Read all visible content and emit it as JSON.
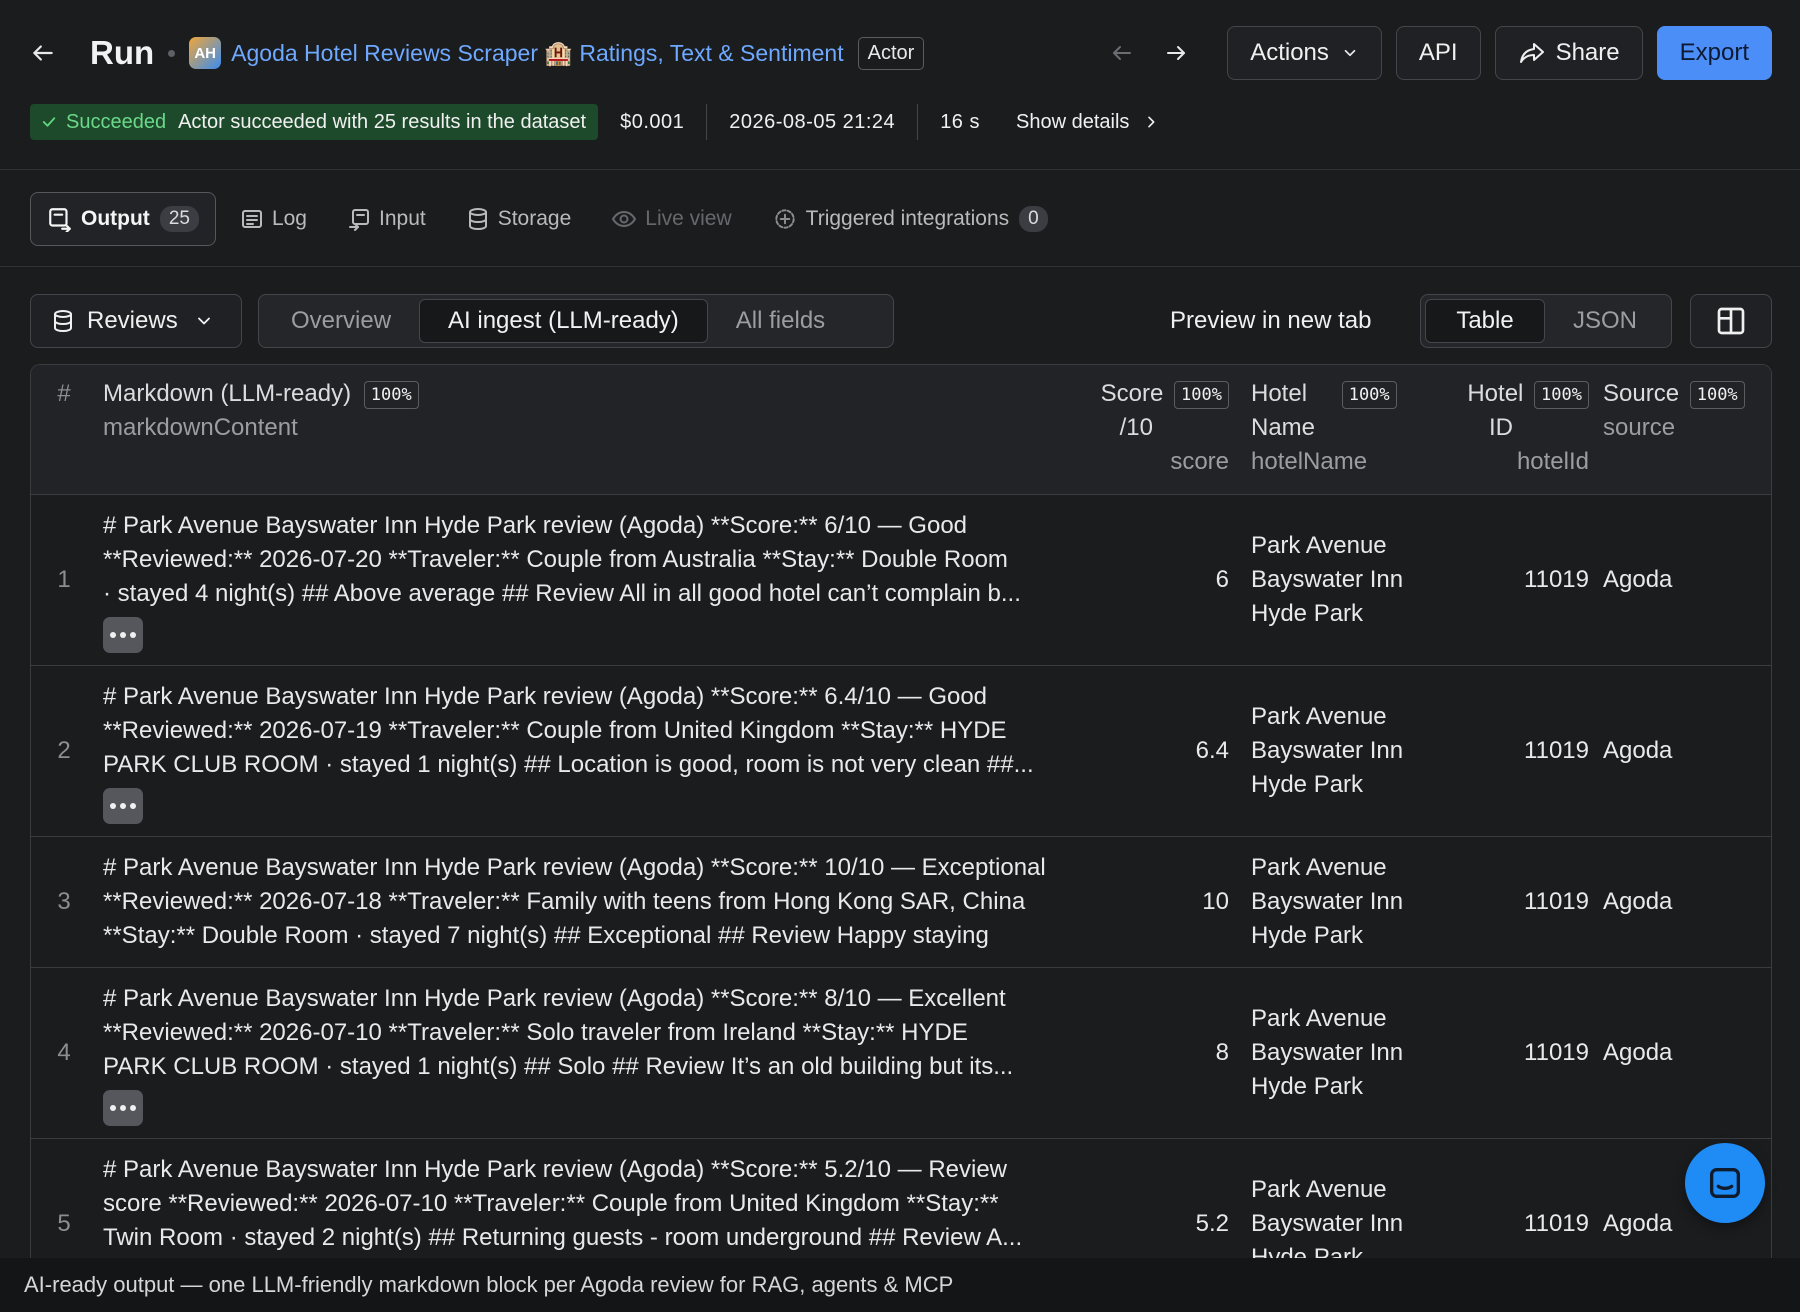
{
  "header": {
    "title": "Run",
    "actor_logo_text": "AH",
    "actor_name": "Agoda Hotel Reviews Scraper 🏨 Ratings, Text & Sentiment",
    "actor_badge": "Actor",
    "actions_label": "Actions",
    "api_label": "API",
    "share_label": "Share",
    "export_label": "Export"
  },
  "status": {
    "label": "Succeeded",
    "message": "Actor succeeded with 25 results in the dataset",
    "cost": "$0.001",
    "started": "2026-08-05 21:24",
    "duration": "16 s",
    "show_details": "Show details"
  },
  "tabs": [
    {
      "label": "Output",
      "count": "25",
      "active": true
    },
    {
      "label": "Log"
    },
    {
      "label": "Input"
    },
    {
      "label": "Storage"
    },
    {
      "label": "Live view",
      "disabled": true
    },
    {
      "label": "Triggered integrations",
      "count": "0"
    }
  ],
  "toolbar": {
    "dataset": "Reviews",
    "views": [
      "Overview",
      "AI ingest (LLM-ready)",
      "All fields"
    ],
    "active_view": "AI ingest (LLM-ready)",
    "preview_label": "Preview in new tab",
    "formats": [
      "Table",
      "JSON"
    ],
    "active_format": "Table"
  },
  "table": {
    "index_header": "#",
    "columns": {
      "markdown": {
        "title": "Markdown (LLM-ready)",
        "pct": "100%",
        "field": "markdownContent"
      },
      "score": {
        "title_line1": "Score",
        "title_line2": "/10",
        "pct": "100%",
        "field": "score"
      },
      "hotel_name": {
        "title_line1": "Hotel",
        "title_line2": "Name",
        "pct": "100%",
        "field": "hotelName"
      },
      "hotel_id": {
        "title_line1": "Hotel",
        "title_line2": "ID",
        "pct": "100%",
        "field": "hotelId"
      },
      "source": {
        "title": "Source",
        "pct": "100%",
        "field": "source"
      }
    },
    "rows": [
      {
        "index": "1",
        "markdown": [
          "# Park Avenue Bayswater Inn Hyde Park review (Agoda) **Score:** 6/10 — Good",
          "**Reviewed:** 2026-07-20 **Traveler:** Couple from Australia **Stay:** Double Room",
          "· stayed 4 night(s) ## Above average ## Review All in all good hotel can’t complain b..."
        ],
        "more": true,
        "score": "6",
        "hotel_name": [
          "Park Avenue",
          "Bayswater Inn",
          "Hyde Park"
        ],
        "hotel_id": "11019",
        "source": "Agoda"
      },
      {
        "index": "2",
        "markdown": [
          "# Park Avenue Bayswater Inn Hyde Park review (Agoda) **Score:** 6.4/10 — Good",
          "**Reviewed:** 2026-07-19 **Traveler:** Couple from United Kingdom **Stay:** HYDE",
          "PARK CLUB ROOM · stayed 1 night(s) ## Location is good, room is not very clean ##..."
        ],
        "more": true,
        "score": "6.4",
        "hotel_name": [
          "Park Avenue",
          "Bayswater Inn",
          "Hyde Park"
        ],
        "hotel_id": "11019",
        "source": "Agoda"
      },
      {
        "index": "3",
        "markdown": [
          "# Park Avenue Bayswater Inn Hyde Park review (Agoda) **Score:** 10/10 — Exceptional",
          "**Reviewed:** 2026-07-18 **Traveler:** Family with teens from Hong Kong SAR, China",
          "**Stay:** Double Room · stayed 7 night(s) ## Exceptional ## Review Happy staying"
        ],
        "more": false,
        "score": "10",
        "hotel_name": [
          "Park Avenue",
          "Bayswater Inn",
          "Hyde Park"
        ],
        "hotel_id": "11019",
        "source": "Agoda"
      },
      {
        "index": "4",
        "markdown": [
          "# Park Avenue Bayswater Inn Hyde Park review (Agoda) **Score:** 8/10 — Excellent",
          "**Reviewed:** 2026-07-10 **Traveler:** Solo traveler from Ireland **Stay:** HYDE",
          "PARK CLUB ROOM · stayed 1 night(s) ## Solo ## Review It’s an old building but its..."
        ],
        "more": true,
        "score": "8",
        "hotel_name": [
          "Park Avenue",
          "Bayswater Inn",
          "Hyde Park"
        ],
        "hotel_id": "11019",
        "source": "Agoda"
      },
      {
        "index": "5",
        "markdown": [
          "# Park Avenue Bayswater Inn Hyde Park review (Agoda) **Score:** 5.2/10 — Review",
          "score **Reviewed:** 2026-07-10 **Traveler:** Couple from United Kingdom **Stay:**",
          "Twin Room · stayed 2 night(s) ## Returning guests - room underground ## Review A..."
        ],
        "more": true,
        "score": "5.2",
        "hotel_name": [
          "Park Avenue",
          "Bayswater Inn",
          "Hyde Park"
        ],
        "hotel_id": "11019",
        "source": "Agoda"
      }
    ]
  },
  "caption": "AI-ready output — one LLM-friendly markdown block per Agoda review for RAG, agents & MCP"
}
